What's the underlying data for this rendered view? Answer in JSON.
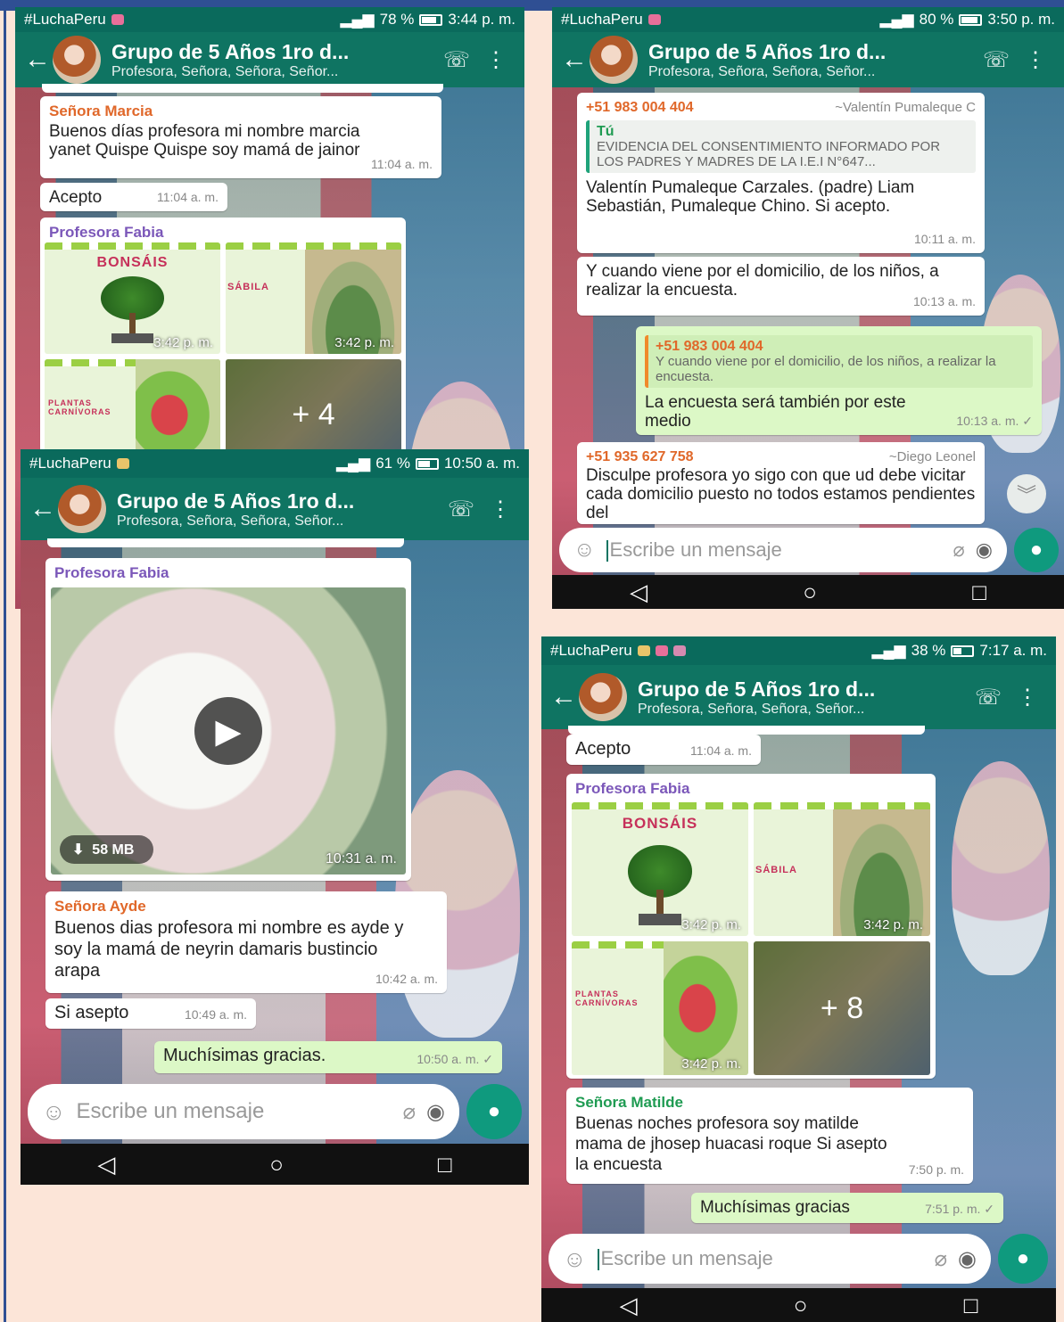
{
  "common": {
    "carrier": "#LuchaPeru",
    "chat_title": "Grupo de 5 Años 1ro d...",
    "chat_subtitle": "Profesora, Señora, Señora, Señor...",
    "input_placeholder": "Escribe un mensaje",
    "net": "4G"
  },
  "s1": {
    "battery": "78 %",
    "clock": "3:44 p. m.",
    "m1_sender": "Señora Marcia",
    "m1_text": "Buenos días profesora mi nombre marcia yanet Quispe Quispe soy mamá de jainor",
    "m1_time": "11:04 a. m.",
    "m2_text": "Acepto",
    "m2_time": "11:04 a. m.",
    "m3_sender": "Profesora Fabia",
    "t1_title": "BONSÁIS",
    "t1_time": "3:42 p. m.",
    "t2_title": "SÁBILA",
    "t2_time": "3:42 p. m.",
    "t3_title": "PLANTAS CARNÍVORAS",
    "t4_more": "+ 4"
  },
  "s2": {
    "battery": "80 %",
    "clock": "3:50 p. m.",
    "m1_sender": "+51 983 004 404",
    "m1_alias": "~Valentín Pumaleque C",
    "m1_quote_sender": "Tú",
    "m1_quote_text": "EVIDENCIA DEL CONSENTIMIENTO INFORMADO POR LOS PADRES Y MADRES DE LA I.E.I N°647...",
    "m1_text": "Valentín Pumaleque Carzales. (padre) Liam Sebastián, Pumaleque Chino. Si acepto.",
    "m1_time": "10:11 a. m.",
    "m2_text": "Y cuando viene por el domicilio, de los niños, a realizar la encuesta.",
    "m2_time": "10:13 a. m.",
    "m3_quote_sender": "+51 983 004 404",
    "m3_quote_text": "Y cuando viene por el domicilio, de los niños, a realizar la encuesta.",
    "m3_text": "La encuesta será también por este medio",
    "m3_time": "10:13 a. m. ✓",
    "m4_sender": "+51 935 627 758",
    "m4_alias": "~Diego Leonel",
    "m4_text": "Disculpe profesora yo sigo con que ud debe vicitar cada domicilio puesto no todos estamos pendientes del"
  },
  "s3": {
    "battery": "61 %",
    "clock": "10:50 a. m.",
    "m1_sender": "Profesora Fabia",
    "video_size": "58 MB",
    "m1_time": "10:31 a. m.",
    "m2_sender": "Señora Ayde",
    "m2_text": "Buenos dias profesora mi nombre es ayde y soy la mamá de neyrin damaris bustincio arapa",
    "m2_time": "10:42 a. m.",
    "m3_text": "Si asepto",
    "m3_time": "10:49 a. m.",
    "m4_text": "Muchísimas gracias.",
    "m4_time": "10:50 a. m. ✓"
  },
  "s4": {
    "battery": "38 %",
    "clock": "7:17 a. m.",
    "m1_text": "Acepto",
    "m1_time": "11:04 a. m.",
    "m2_sender": "Profesora Fabia",
    "t1_title": "BONSÁIS",
    "t1_time": "3:42 p. m.",
    "t2_title": "SÁBILA",
    "t2_time": "3:42 p. m.",
    "t3_title": "PLANTAS CARNÍVORAS",
    "t3_time": "3:42 p. m.",
    "t4_more": "+ 8",
    "m3_sender": "Señora Matilde",
    "m3_text": "Buenas noches profesora soy matilde mama de jhosep huacasi roque Si asepto la encuesta",
    "m3_time": "7:50 p. m.",
    "m4_text": "Muchísimas gracias",
    "m4_time": "7:51 p. m. ✓"
  },
  "colors": {
    "header": "#0f7462",
    "status": "#0a6a5c",
    "outgoing": "#dcf8c6",
    "page": "#fce5d8",
    "frame": "#2f4f93"
  }
}
